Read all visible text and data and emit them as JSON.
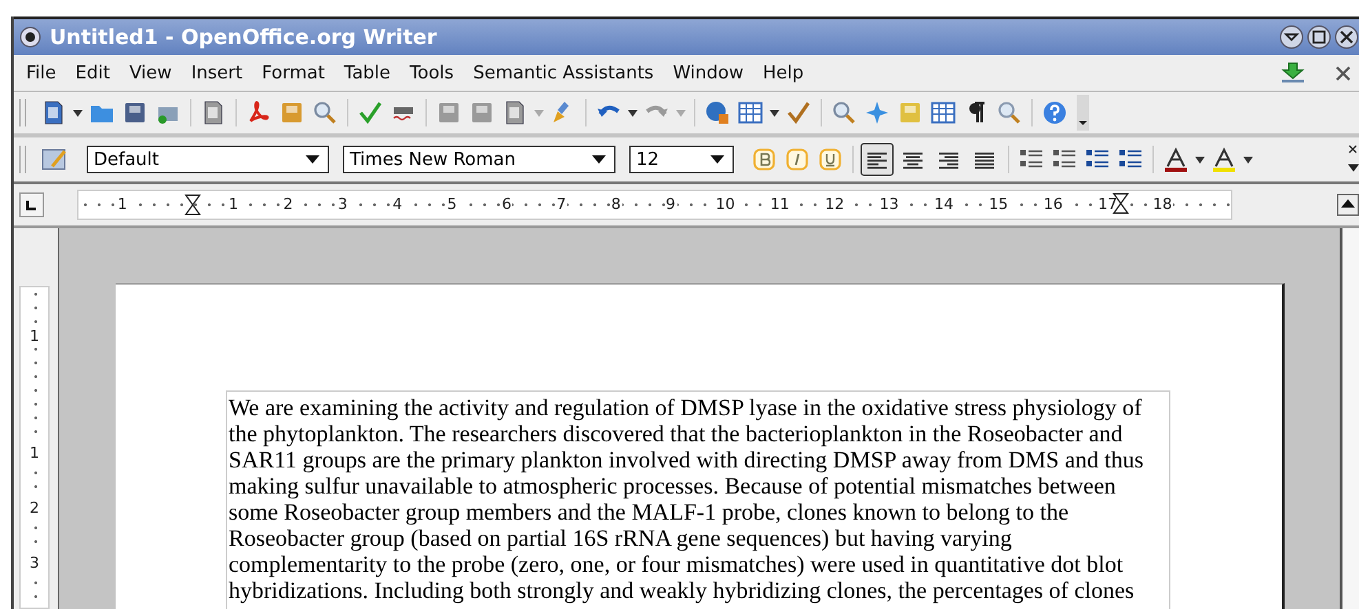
{
  "window": {
    "title": "Untitled1 - OpenOffice.org Writer"
  },
  "menu": [
    "File",
    "Edit",
    "View",
    "Insert",
    "Format",
    "Table",
    "Tools",
    "Semantic Assistants",
    "Window",
    "Help"
  ],
  "format_bar": {
    "style": "Default",
    "font": "Times New Roman",
    "size": "12",
    "alignment": [
      {
        "kind": "left",
        "selected": true
      },
      {
        "kind": "center",
        "selected": false
      },
      {
        "kind": "right",
        "selected": false
      },
      {
        "kind": "justify",
        "selected": false
      }
    ]
  },
  "ruler": {
    "labels": [
      "1",
      "1",
      "2",
      "3",
      "4",
      "5",
      "6",
      "7",
      "8",
      "9",
      "10",
      "11",
      "12",
      "13",
      "14",
      "15",
      "16",
      "17",
      "18"
    ]
  },
  "vertical_ruler": {
    "labels": [
      "1",
      "1",
      "2",
      "3"
    ]
  },
  "document": {
    "lines": [
      "We are examining the activity and regulation of DMSP lyase in the oxidative stress physiology of",
      "the phytoplankton. The researchers discovered that the bacterioplankton in the Roseobacter and",
      "SAR11 groups are the primary plankton involved with directing DMSP away from DMS and thus",
      "making sulfur unavailable to atmospheric processes. Because of potential mismatches between",
      "some Roseobacter group members and the MALF-1 probe, clones known to belong to the",
      "Roseobacter group (based on partial 16S rRNA gene sequences) but having varying",
      "complementarity to the probe (zero, one, or four mismatches) were used in quantitative dot blot",
      "hybridizations. Including both strongly and weakly hybridizing clones, the percentages of clones"
    ]
  }
}
